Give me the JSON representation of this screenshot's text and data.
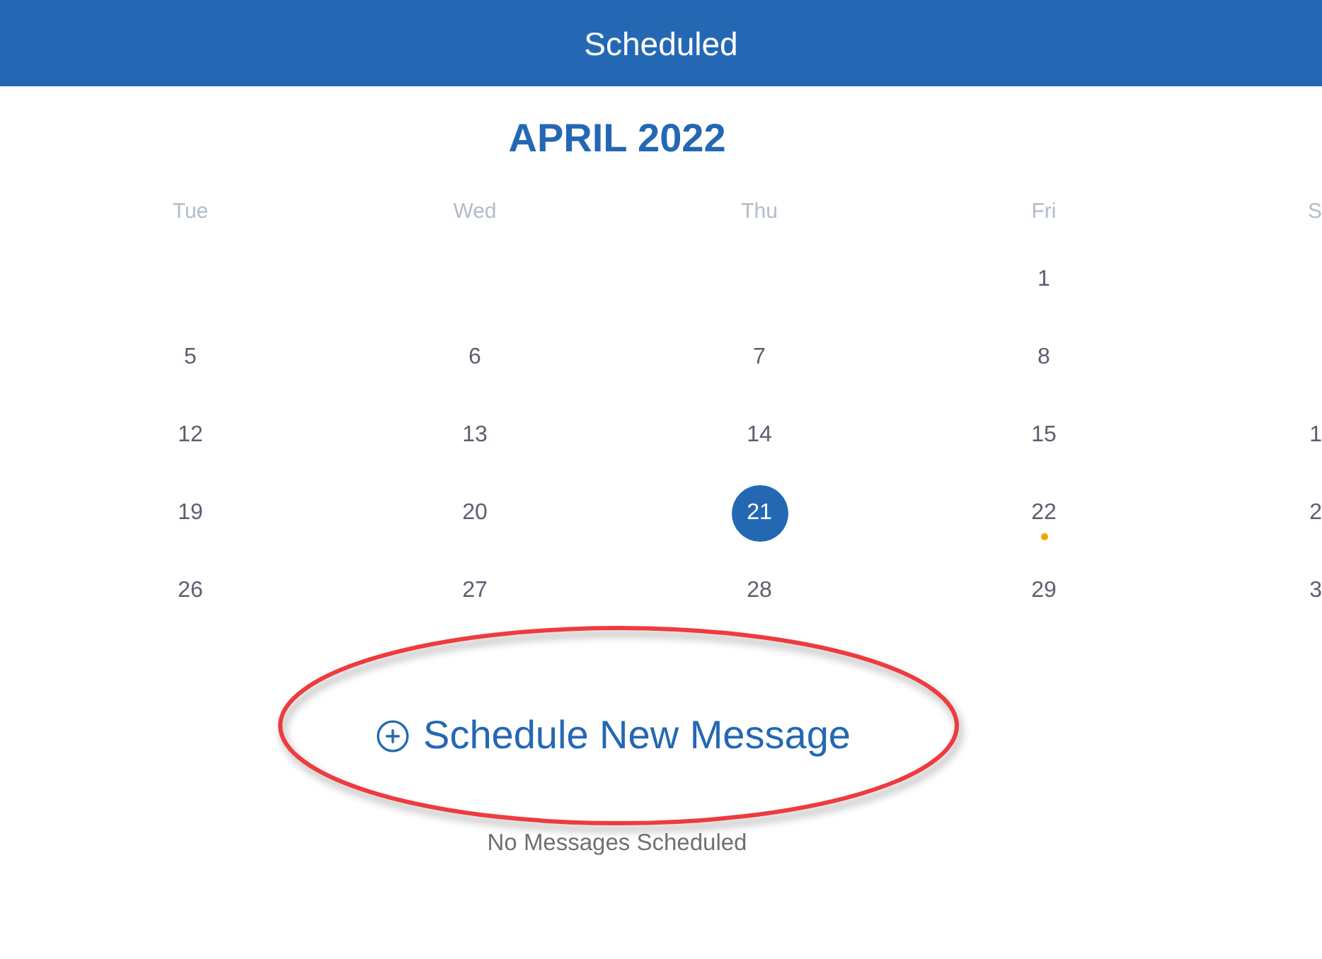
{
  "header": {
    "title": "Scheduled"
  },
  "calendar": {
    "month": "APRIL 2022",
    "weekdays": [
      "Tue",
      "Wed",
      "Thu",
      "Fri",
      "S"
    ],
    "weeks": [
      {
        "days": [
          {
            "kind": "empty"
          },
          {
            "kind": "empty"
          },
          {
            "kind": "empty"
          },
          {
            "kind": "date",
            "label": "1",
            "selected": false,
            "has_event": false
          },
          {
            "kind": "empty"
          }
        ]
      },
      {
        "days": [
          {
            "kind": "date",
            "label": "5",
            "selected": false,
            "has_event": false
          },
          {
            "kind": "date",
            "label": "6",
            "selected": false,
            "has_event": false
          },
          {
            "kind": "date",
            "label": "7",
            "selected": false,
            "has_event": false
          },
          {
            "kind": "date",
            "label": "8",
            "selected": false,
            "has_event": false
          },
          {
            "kind": "empty"
          }
        ]
      },
      {
        "days": [
          {
            "kind": "date",
            "label": "12",
            "selected": false,
            "has_event": false
          },
          {
            "kind": "date",
            "label": "13",
            "selected": false,
            "has_event": false
          },
          {
            "kind": "date",
            "label": "14",
            "selected": false,
            "has_event": false
          },
          {
            "kind": "date",
            "label": "15",
            "selected": false,
            "has_event": false
          },
          {
            "kind": "date",
            "label": "1",
            "selected": false,
            "has_event": false
          }
        ]
      },
      {
        "days": [
          {
            "kind": "date",
            "label": "19",
            "selected": false,
            "has_event": false
          },
          {
            "kind": "date",
            "label": "20",
            "selected": false,
            "has_event": false
          },
          {
            "kind": "date",
            "label": "21",
            "selected": true,
            "has_event": false
          },
          {
            "kind": "date",
            "label": "22",
            "selected": false,
            "has_event": true
          },
          {
            "kind": "date",
            "label": "2",
            "selected": false,
            "has_event": false
          }
        ]
      },
      {
        "days": [
          {
            "kind": "date",
            "label": "26",
            "selected": false,
            "has_event": false
          },
          {
            "kind": "date",
            "label": "27",
            "selected": false,
            "has_event": false
          },
          {
            "kind": "date",
            "label": "28",
            "selected": false,
            "has_event": false
          },
          {
            "kind": "date",
            "label": "29",
            "selected": false,
            "has_event": false
          },
          {
            "kind": "date",
            "label": "3",
            "selected": false,
            "has_event": false
          }
        ]
      }
    ]
  },
  "actions": {
    "schedule_button": "Schedule New Message",
    "empty_message": "No Messages Scheduled"
  },
  "highlight": {
    "kind": "ellipse"
  }
}
